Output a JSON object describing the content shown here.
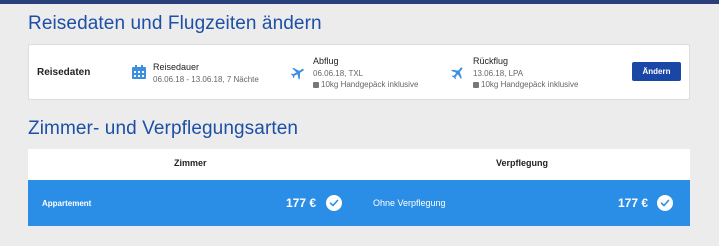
{
  "travel": {
    "heading": "Reisedaten und Flugzeiten ändern",
    "label": "Reisedaten",
    "duration": {
      "title": "Reisedauer",
      "value": "06.06.18 - 13.06.18,  7 Nächte",
      "icon": "calendar-icon"
    },
    "departure": {
      "title": "Abflug",
      "value": "06.06.18, TXL",
      "baggage": "10kg Handgepäck inklusive",
      "icon": "plane-departure-icon"
    },
    "return": {
      "title": "Rückflug",
      "value": "13.06.18, LPA",
      "baggage": "10kg Handgepäck inklusive",
      "icon": "plane-return-icon"
    },
    "change_button": "Ändern"
  },
  "rooms": {
    "heading": "Zimmer- und Verpflegungsarten",
    "col_room": "Zimmer",
    "col_meal": "Verpflegung",
    "selected": {
      "room": "Appartement",
      "room_price": "177 €",
      "meal": "Ohne Verpflegung",
      "meal_price": "177 €"
    }
  },
  "colors": {
    "accent": "#1d4fa6",
    "selected_row": "#2b8ee6",
    "button": "#1a47a6",
    "icon": "#3a8fe0"
  }
}
